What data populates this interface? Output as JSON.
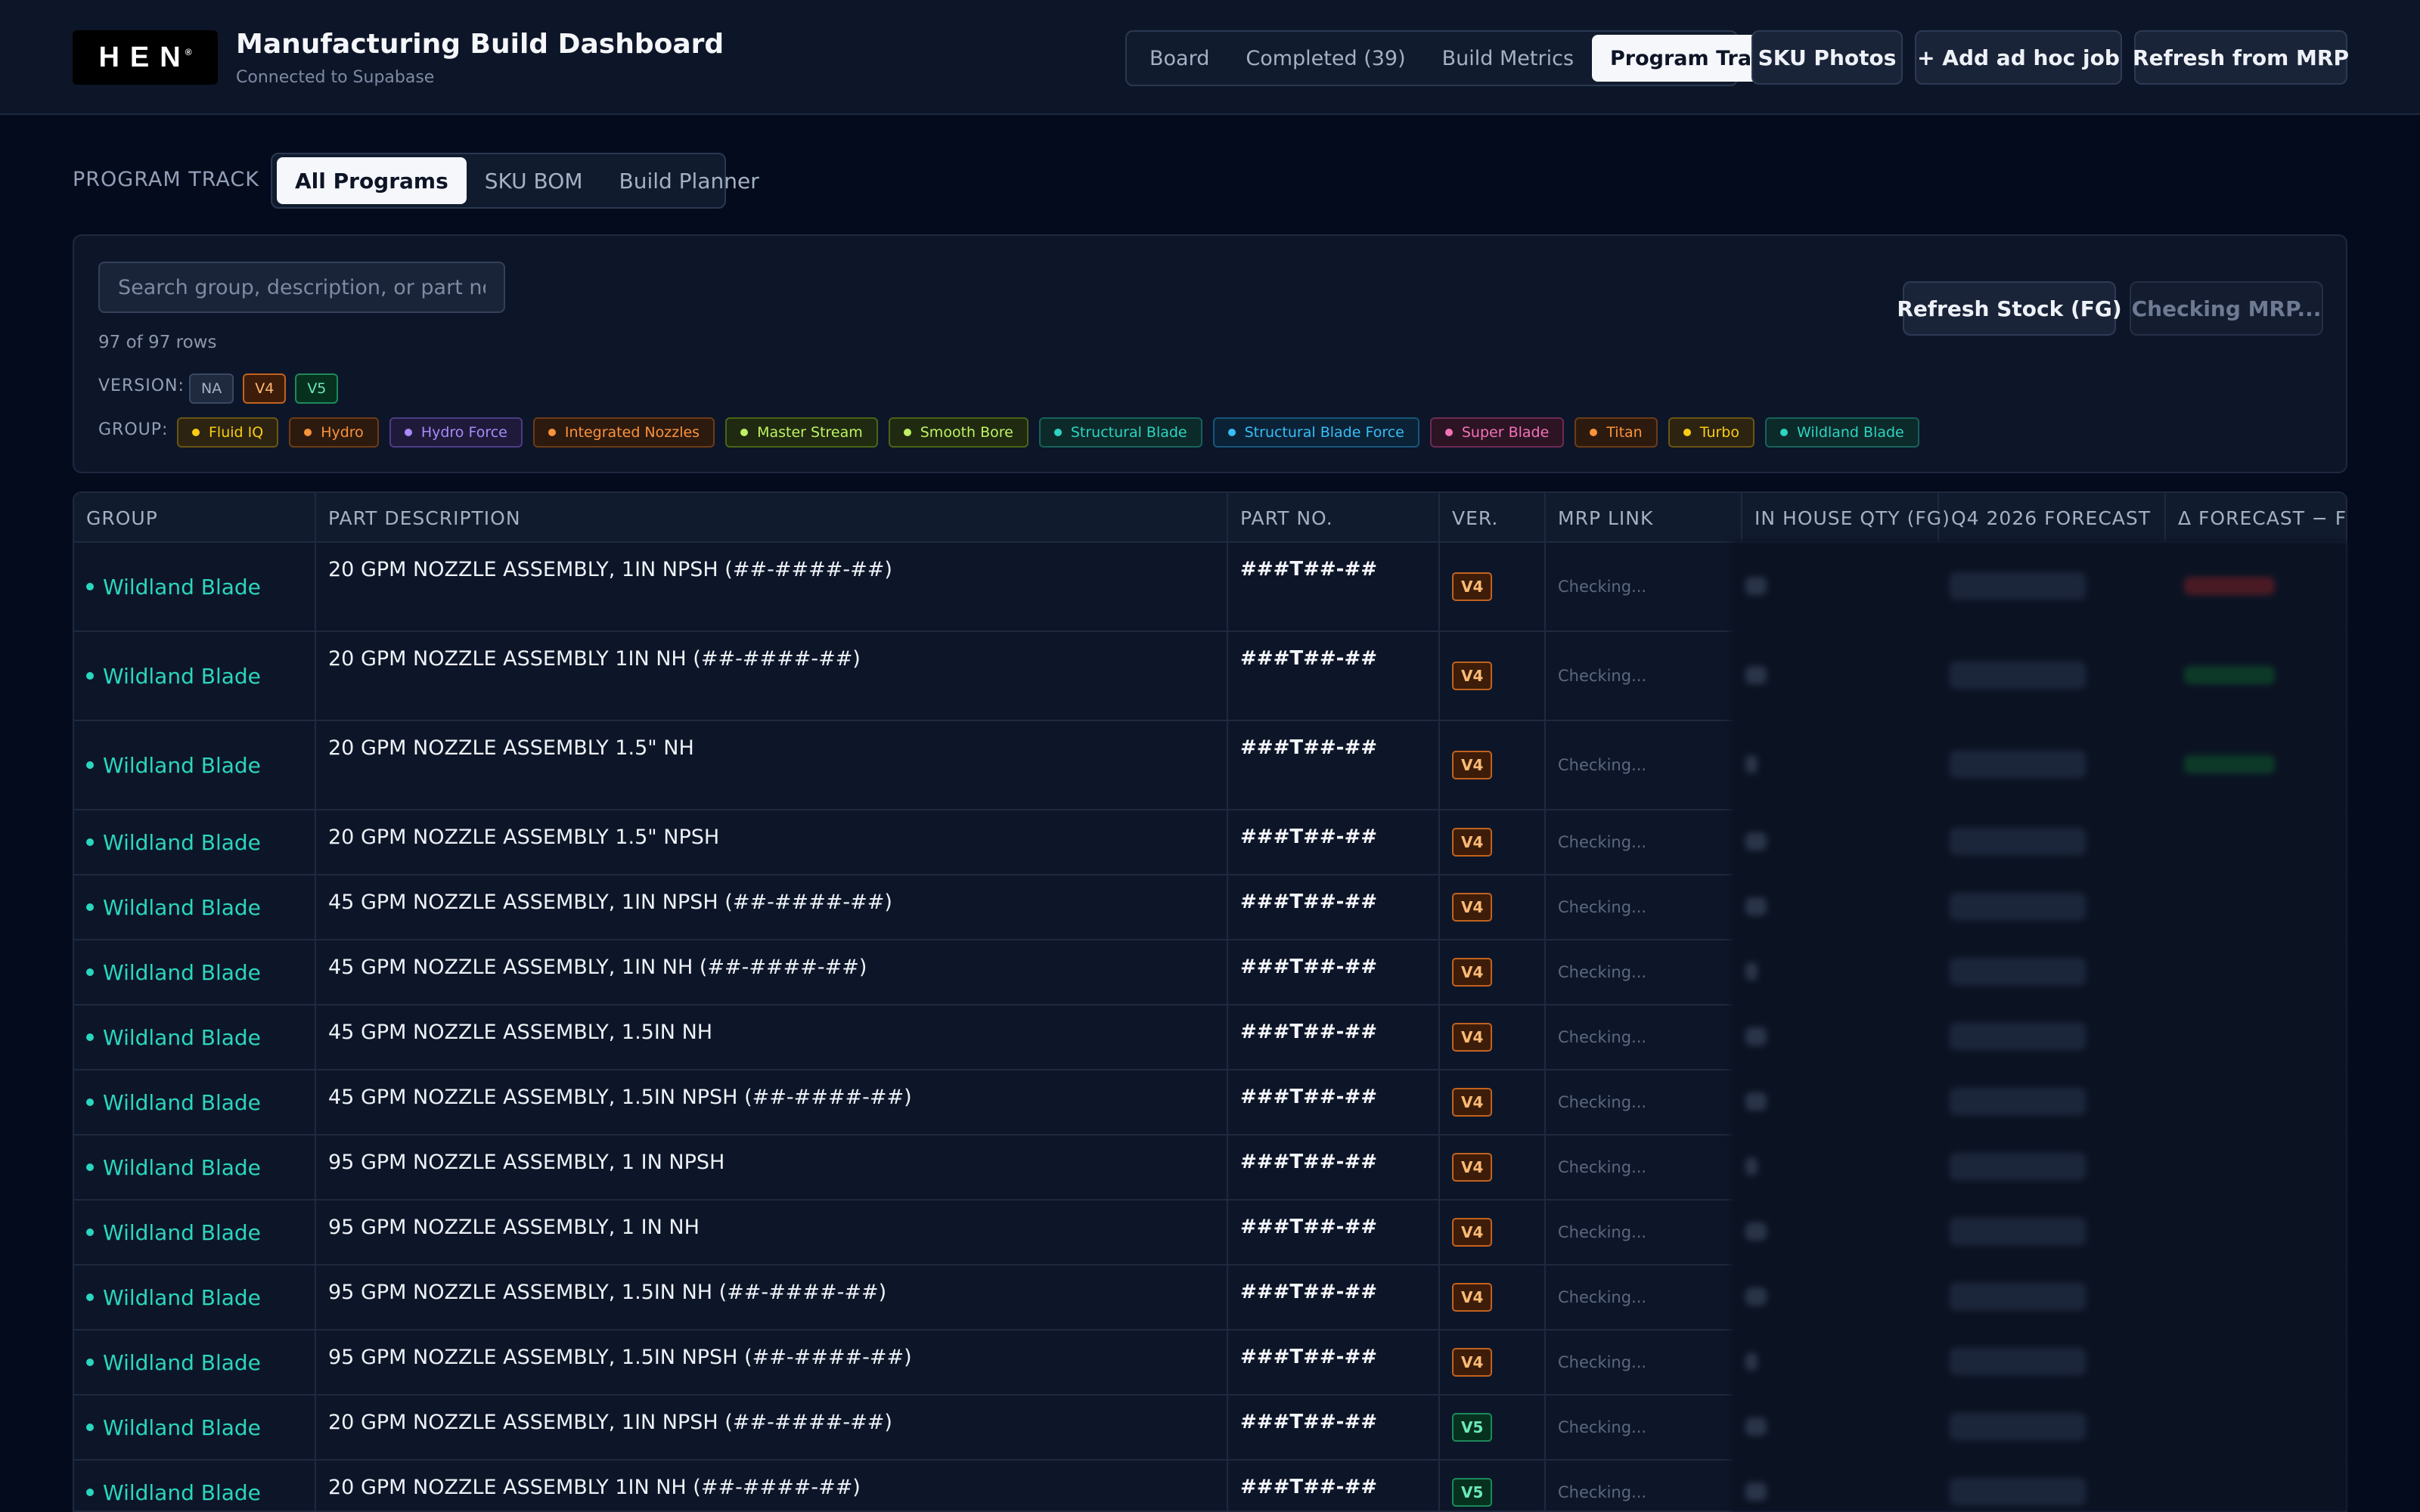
{
  "header": {
    "logo_text": "HEN",
    "logo_mark": "®",
    "title": "Manufacturing Build Dashboard",
    "subtitle": "Connected to Supabase",
    "tabs": [
      "Board",
      "Completed (39)",
      "Build Metrics",
      "Program Track"
    ],
    "active_tab": "Program Track",
    "sku_photos": "SKU Photos",
    "add_job": "+ Add ad hoc job",
    "refresh_mrp": "Refresh from MRP"
  },
  "program_track": {
    "label": "PROGRAM TRACK",
    "tabs": [
      "All Programs",
      "SKU BOM",
      "Build Planner"
    ],
    "active_tab": "All Programs"
  },
  "filters": {
    "search_placeholder": "Search group, description, or part no...",
    "row_count": "97 of 97 rows",
    "version_label": "VERSION:",
    "versions": [
      {
        "label": "NA",
        "bg": "#1f2a3e",
        "border": "#3a4864",
        "color": "#a4b0c4"
      },
      {
        "label": "V4",
        "bg": "#3d1d09",
        "border": "#c2621f",
        "color": "#fdba74"
      },
      {
        "label": "V5",
        "bg": "#06311f",
        "border": "#1c8a5a",
        "color": "#6ee7b7"
      }
    ],
    "group_label": "GROUP:",
    "groups": [
      {
        "label": "Fluid IQ",
        "color": "#facc15",
        "bg": "#2c2410",
        "border": "#6b5414"
      },
      {
        "label": "Hydro",
        "color": "#fb923c",
        "bg": "#2d1a0e",
        "border": "#6e3b16"
      },
      {
        "label": "Hydro Force",
        "color": "#a78bfa",
        "bg": "#1f1a3a",
        "border": "#4b3c86"
      },
      {
        "label": "Integrated Nozzles",
        "color": "#fb923c",
        "bg": "#2d1a0e",
        "border": "#6e3b16"
      },
      {
        "label": "Master Stream",
        "color": "#bef264",
        "bg": "#1f2a10",
        "border": "#4a6418"
      },
      {
        "label": "Smooth Bore",
        "color": "#bef264",
        "bg": "#1f2a10",
        "border": "#4a6418"
      },
      {
        "label": "Structural Blade",
        "color": "#2dd4bf",
        "bg": "#0c2a2a",
        "border": "#17615a"
      },
      {
        "label": "Structural Blade Force",
        "color": "#38bdf8",
        "bg": "#0b2236",
        "border": "#18557a"
      },
      {
        "label": "Super Blade",
        "color": "#f472b6",
        "bg": "#2c1424",
        "border": "#6e2a54"
      },
      {
        "label": "Titan",
        "color": "#fb923c",
        "bg": "#2d1a0e",
        "border": "#6e3b16"
      },
      {
        "label": "Turbo",
        "color": "#facc15",
        "bg": "#2c2410",
        "border": "#6b5414"
      },
      {
        "label": "Wildland Blade",
        "color": "#2dd4bf",
        "bg": "#0c2a2a",
        "border": "#17615a"
      }
    ],
    "refresh_stock": "Refresh Stock (FG)",
    "checking_mrp": "Checking MRP..."
  },
  "table": {
    "columns": [
      "GROUP",
      "PART DESCRIPTION",
      "PART NO.",
      "VER.",
      "MRP LINK",
      "IN HOUSE QTY (FG)",
      "Q4 2026 FORECAST",
      "Δ FORECAST − FG"
    ],
    "rows": [
      {
        "group": "Wildland Blade",
        "desc": "20 GPM NOZZLE ASSEMBLY, 1IN NPSH (##-####-##)",
        "part": "###T##-##",
        "ver": "V4",
        "mrp": "Checking..."
      },
      {
        "group": "Wildland Blade",
        "desc": "20 GPM NOZZLE ASSEMBLY 1IN NH (##-####-##)",
        "part": "###T##-##",
        "ver": "V4",
        "mrp": "Checking..."
      },
      {
        "group": "Wildland Blade",
        "desc": "20 GPM NOZZLE ASSEMBLY 1.5\" NH",
        "part": "###T##-##",
        "ver": "V4",
        "mrp": "Checking..."
      },
      {
        "group": "Wildland Blade",
        "desc": "20 GPM NOZZLE ASSEMBLY 1.5\" NPSH",
        "part": "###T##-##",
        "ver": "V4",
        "mrp": "Checking..."
      },
      {
        "group": "Wildland Blade",
        "desc": "45 GPM NOZZLE ASSEMBLY, 1IN NPSH (##-####-##)",
        "part": "###T##-##",
        "ver": "V4",
        "mrp": "Checking..."
      },
      {
        "group": "Wildland Blade",
        "desc": "45 GPM NOZZLE ASSEMBLY, 1IN NH (##-####-##)",
        "part": "###T##-##",
        "ver": "V4",
        "mrp": "Checking..."
      },
      {
        "group": "Wildland Blade",
        "desc": "45 GPM NOZZLE ASSEMBLY, 1.5IN NH",
        "part": "###T##-##",
        "ver": "V4",
        "mrp": "Checking..."
      },
      {
        "group": "Wildland Blade",
        "desc": "45 GPM NOZZLE ASSEMBLY, 1.5IN NPSH (##-####-##)",
        "part": "###T##-##",
        "ver": "V4",
        "mrp": "Checking..."
      },
      {
        "group": "Wildland Blade",
        "desc": "95 GPM NOZZLE ASSEMBLY, 1 IN NPSH",
        "part": "###T##-##",
        "ver": "V4",
        "mrp": "Checking..."
      },
      {
        "group": "Wildland Blade",
        "desc": "95 GPM NOZZLE ASSEMBLY, 1 IN NH",
        "part": "###T##-##",
        "ver": "V4",
        "mrp": "Checking..."
      },
      {
        "group": "Wildland Blade",
        "desc": "95 GPM NOZZLE ASSEMBLY, 1.5IN NH (##-####-##)",
        "part": "###T##-##",
        "ver": "V4",
        "mrp": "Checking..."
      },
      {
        "group": "Wildland Blade",
        "desc": "95 GPM NOZZLE ASSEMBLY, 1.5IN NPSH (##-####-##)",
        "part": "###T##-##",
        "ver": "V4",
        "mrp": "Checking..."
      },
      {
        "group": "Wildland Blade",
        "desc": "20 GPM NOZZLE ASSEMBLY, 1IN NPSH (##-####-##)",
        "part": "###T##-##",
        "ver": "V5",
        "mrp": "Checking..."
      },
      {
        "group": "Wildland Blade",
        "desc": "20 GPM NOZZLE ASSEMBLY 1IN NH (##-####-##)",
        "part": "###T##-##",
        "ver": "V5",
        "mrp": "Checking..."
      }
    ]
  }
}
